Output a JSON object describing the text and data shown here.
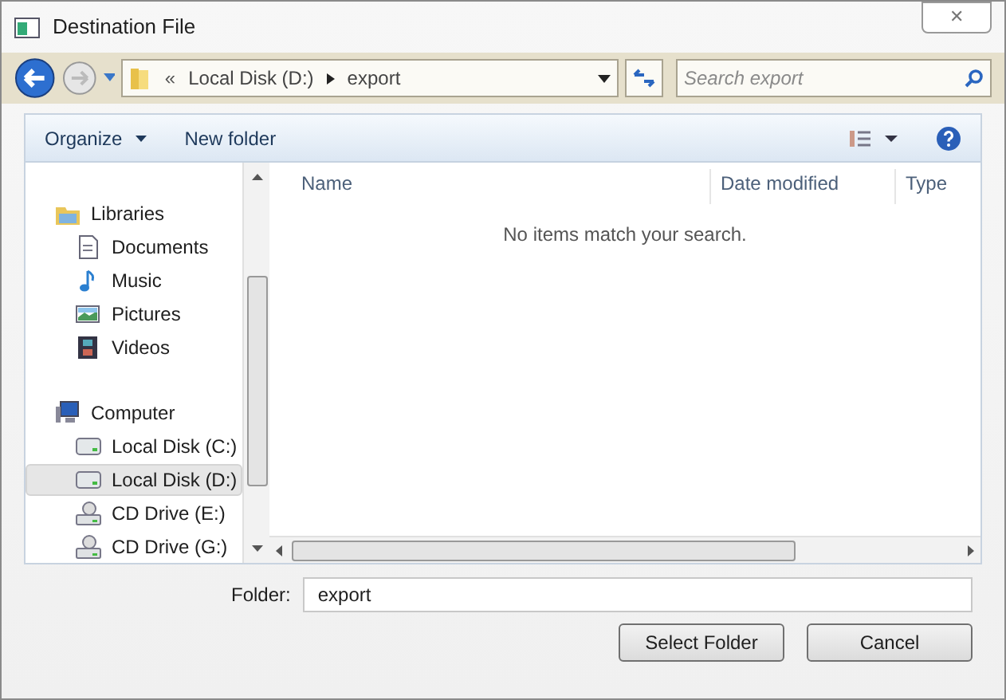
{
  "window": {
    "title": "Destination File",
    "close": "✕"
  },
  "address": {
    "overflow": "«",
    "crumbs": [
      "Local Disk (D:)",
      "export"
    ]
  },
  "search": {
    "placeholder": "Search export"
  },
  "toolbar": {
    "organize": "Organize",
    "new_folder": "New folder"
  },
  "sidebar": {
    "groups": [
      {
        "label": "Libraries",
        "kind": "library",
        "children": [
          {
            "label": "Documents",
            "kind": "document",
            "selected": false
          },
          {
            "label": "Music",
            "kind": "music",
            "selected": false
          },
          {
            "label": "Pictures",
            "kind": "pictures",
            "selected": false
          },
          {
            "label": "Videos",
            "kind": "videos",
            "selected": false
          }
        ]
      },
      {
        "label": "Computer",
        "kind": "computer",
        "children": [
          {
            "label": "Local Disk (C:)",
            "kind": "disk",
            "selected": false
          },
          {
            "label": "Local Disk (D:)",
            "kind": "disk",
            "selected": true
          },
          {
            "label": "CD Drive (E:)",
            "kind": "cd",
            "selected": false
          },
          {
            "label": "CD Drive (G:)",
            "kind": "cd",
            "selected": false
          }
        ]
      }
    ]
  },
  "columns": [
    "Name",
    "Date modified",
    "Type"
  ],
  "empty_message": "No items match your search.",
  "folder": {
    "label": "Folder:",
    "value": "export"
  },
  "buttons": [
    "Select Folder",
    "Cancel"
  ]
}
